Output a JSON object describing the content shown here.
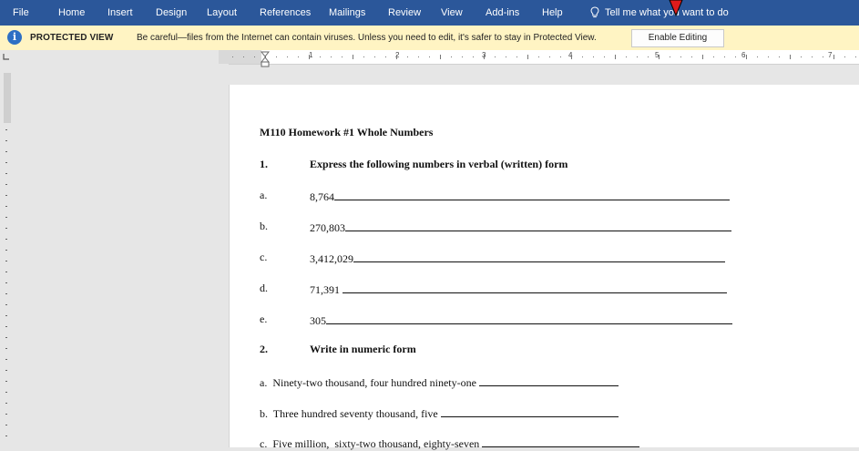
{
  "ribbon": {
    "tabs": [
      "File",
      "Home",
      "Insert",
      "Design",
      "Layout",
      "References",
      "Mailings",
      "Review",
      "View",
      "Add-ins",
      "Help"
    ],
    "tell_me": "Tell me what you want to do",
    "colors": {
      "background": "#2b579a",
      "text": "#ffffff"
    }
  },
  "protected_view": {
    "icon": "info-icon",
    "title": "PROTECTED VIEW",
    "message": "Be careful—files from the Internet can contain viruses. Unless you need to edit, it's safer to stay in Protected View.",
    "button": "Enable Editing",
    "colors": {
      "background": "#fff4c3",
      "icon": "#2e6fc4"
    }
  },
  "ruler": {
    "numbers": [
      "1",
      "2",
      "3",
      "4",
      "5",
      "6",
      "7"
    ]
  },
  "document": {
    "title": "M110 Homework #1 Whole Numbers",
    "section1": {
      "number": "1.",
      "heading": "Express the following numbers in verbal (written) form",
      "items": [
        {
          "letter": "a.",
          "value": "8,764"
        },
        {
          "letter": "b.",
          "value": "270,803"
        },
        {
          "letter": "c.",
          "value": "3,412,029"
        },
        {
          "letter": "d.",
          "value": "71,391"
        },
        {
          "letter": "e.",
          "value": "305"
        }
      ]
    },
    "section2": {
      "number": "2.",
      "heading": "Write in numeric form",
      "items": [
        {
          "text": "a.  Ninety-two thousand, four hundred ninety-one"
        },
        {
          "text": "b.  Three hundred seventy thousand, five"
        },
        {
          "text": "c.  Five million,  sixty-two thousand, eighty-seven"
        }
      ]
    }
  }
}
